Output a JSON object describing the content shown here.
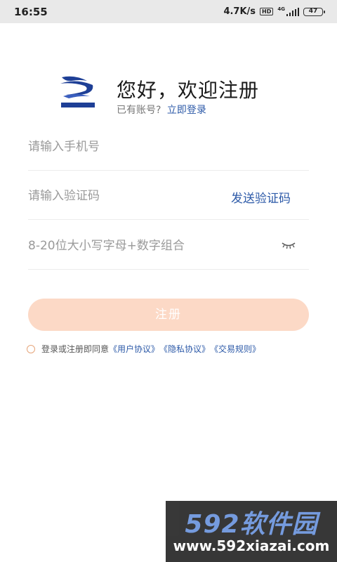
{
  "status_bar": {
    "time": "16:55",
    "speed": "4.7K/s",
    "hd_badge": "HD",
    "network": "4G",
    "battery": "47"
  },
  "header": {
    "greeting": "您好，欢迎注册",
    "has_account": "已有账号?",
    "login_link": "立即登录"
  },
  "form": {
    "phone_placeholder": "请输入手机号",
    "code_placeholder": "请输入验证码",
    "send_code": "发送验证码",
    "password_placeholder": "8-20位大小写字母+数字组合"
  },
  "register_button": "注册",
  "agreement": {
    "prefix": "登录或注册即同意",
    "user_agreement": "《用户协议》",
    "privacy_agreement": "《隐私协议》",
    "trade_rules": "《交易规则》"
  },
  "watermark": {
    "brand": "592软件园",
    "url": "www.592xiazai.com"
  },
  "colors": {
    "accent_link": "#2d5aa8",
    "button_bg": "#fcd9c6",
    "radio_border": "#e6a57a"
  }
}
